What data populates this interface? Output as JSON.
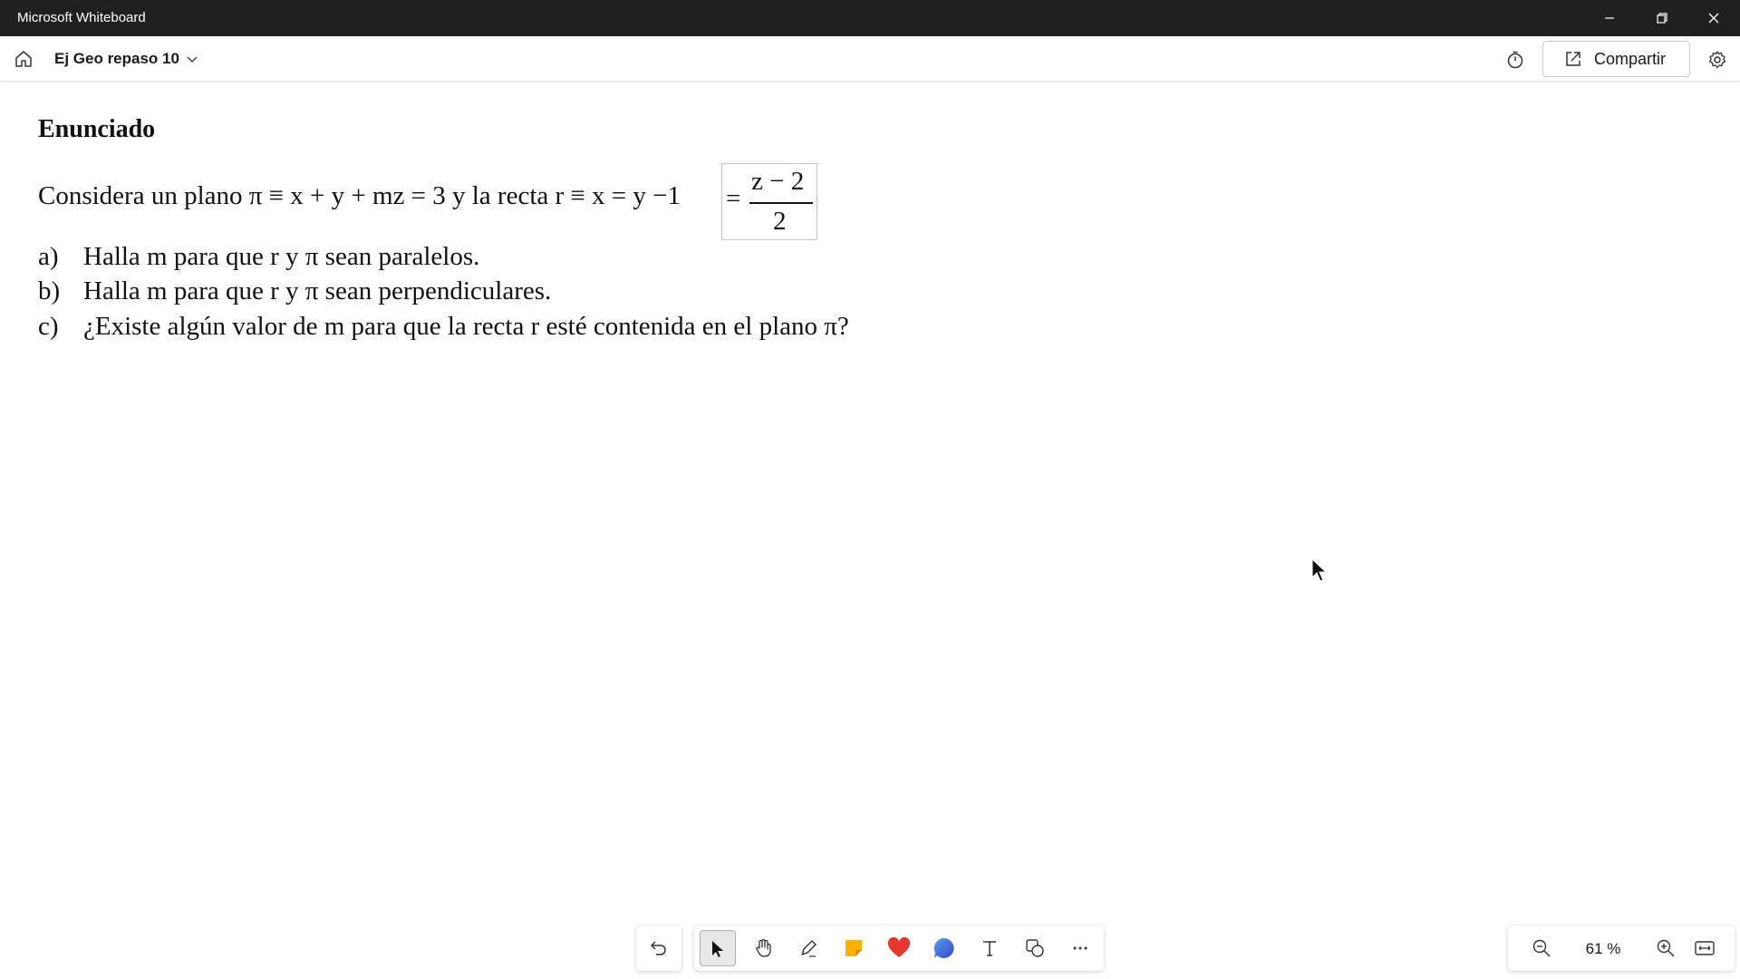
{
  "window": {
    "title": "Microsoft Whiteboard",
    "controls": [
      "minimize-icon",
      "restore-icon",
      "close-icon"
    ]
  },
  "appbar": {
    "board_title": "Ej Geo repaso 10",
    "share_label": "Compartir",
    "icons": [
      "home-icon",
      "chevron-down-icon",
      "timer-icon",
      "share-icon",
      "gear-icon"
    ]
  },
  "content": {
    "heading": "Enunciado",
    "statement": "Considera un plano π ≡ x + y + mz = 3 y la recta r ≡ x = y −1",
    "fraction": {
      "equals": "=",
      "numerator": "z − 2",
      "denominator": "2"
    },
    "questions": [
      {
        "letter": "a)",
        "text": "Halla m para que r y π sean paralelos."
      },
      {
        "letter": "b)",
        "text": "Halla m para que r y π sean perpendiculares."
      },
      {
        "letter": "c)",
        "text": "¿Existe algún valor de m para que la recta r esté contenida en el plano π?"
      }
    ]
  },
  "toolbar": {
    "tools": [
      "undo-icon",
      "select-icon",
      "pan-hand-icon",
      "pen-icon",
      "sticky-note-icon",
      "reaction-heart-icon",
      "comment-icon",
      "text-icon",
      "shapes-icon",
      "more-icon"
    ],
    "active_tool": "select-icon"
  },
  "zoom": {
    "level": "61 %",
    "icons": [
      "zoom-out-icon",
      "zoom-in-icon",
      "fit-to-screen-icon"
    ]
  },
  "colors": {
    "titlebar": "#202020",
    "sticky": "#ffb300",
    "heart": "#e5372c",
    "comment": "#3b6fe0"
  }
}
